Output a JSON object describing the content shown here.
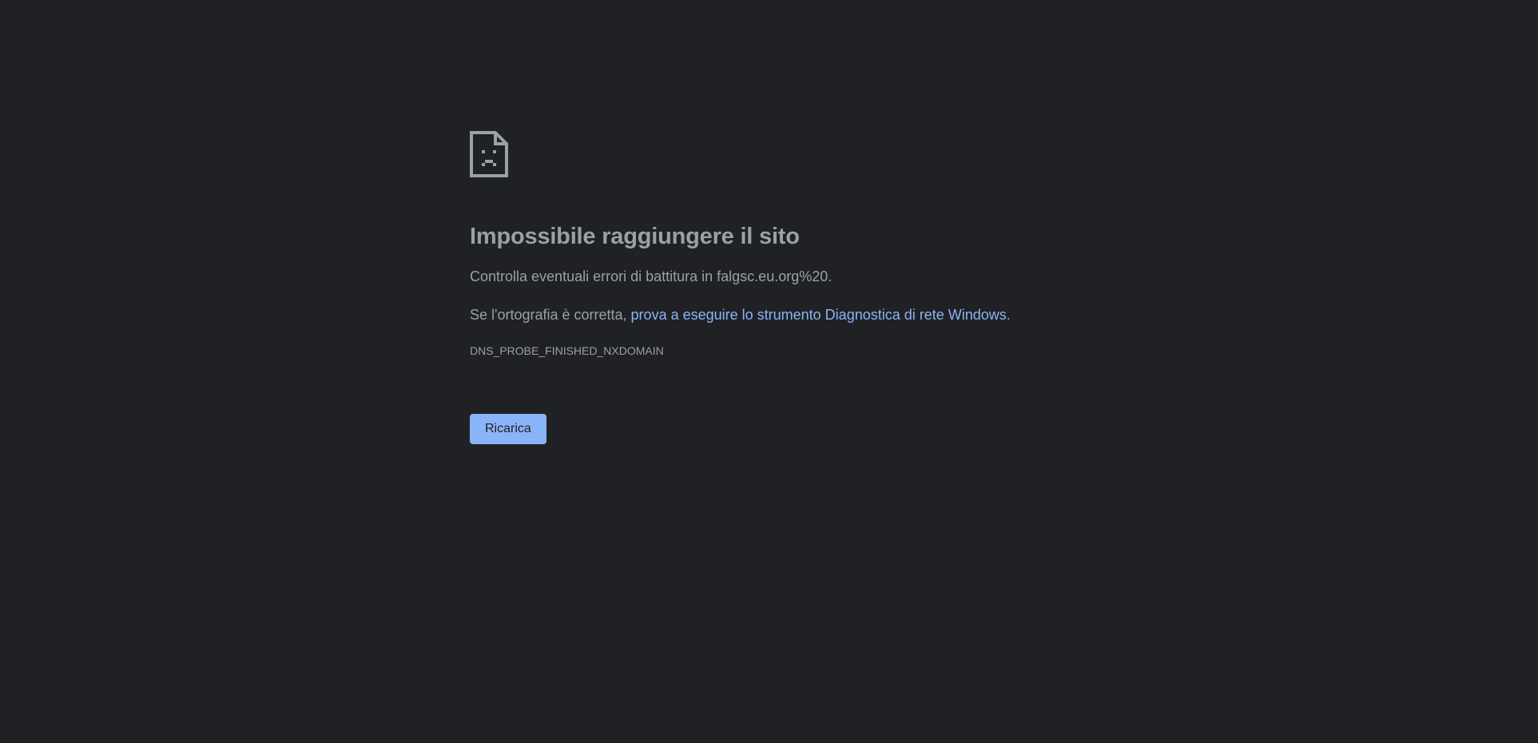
{
  "error": {
    "icon": "sad-document-icon",
    "title": "Impossibile raggiungere il sito",
    "line1": "Controlla eventuali errori di battitura in falgsc.eu.org%20.",
    "line2_prefix": "Se l'ortografia è corretta, ",
    "line2_link": "prova a eseguire lo strumento Diagnostica di rete Windows",
    "line2_suffix": ".",
    "code": "DNS_PROBE_FINISHED_NXDOMAIN"
  },
  "actions": {
    "reload_label": "Ricarica"
  },
  "colors": {
    "background": "#202124",
    "text": "#9aa0a6",
    "link": "#8ab4f8",
    "button_bg": "#8ab4f8",
    "button_text": "#202124"
  }
}
